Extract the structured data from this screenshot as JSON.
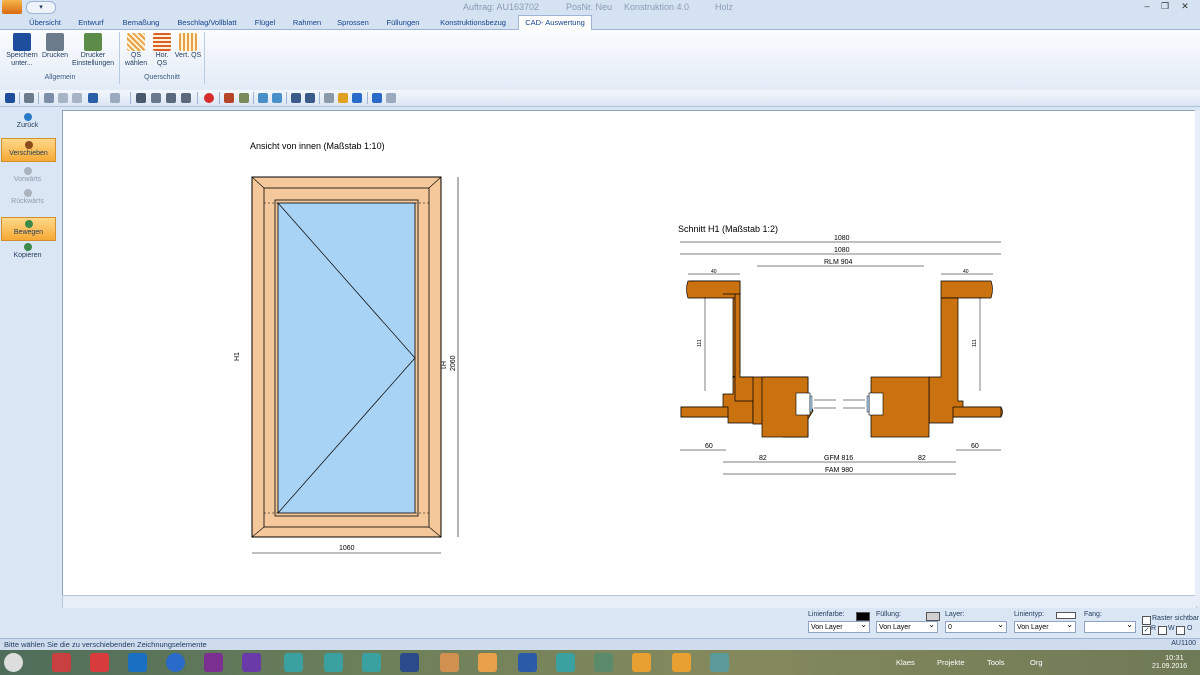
{
  "titlebar": {
    "quick_access": "▾",
    "auftrag": "Auftrag: AU163702",
    "posnr": "PosNr. Neu",
    "konstruktion": "Konstruktion 4.0",
    "material": "Holz",
    "minimize": "–",
    "restore": "❐",
    "close": "✕"
  },
  "tabs": [
    "Übersicht",
    "Entwurf",
    "Bemaßung",
    "Beschlag/Vollblatt",
    "Flügel",
    "Rahmen",
    "Sprossen",
    "Füllungen",
    "Konstruktionsbezug",
    "CAD- Auswertung"
  ],
  "ribbon": {
    "save": "Speichern unter...",
    "print": "Drucken",
    "printer": "Drucker Einstellungen",
    "group_allgemein": "Allgemein",
    "qs_waehlen": "QS wählen",
    "hor_qs": "Hor. QS",
    "vert_qs": "Vert. QS",
    "group_querschnitt": "Querschnitt"
  },
  "left_panel": {
    "back": "Zurück",
    "move_shift": "Verschieben",
    "forward": "Vorwärts",
    "backward": "Rückwärts",
    "move": "Bewegen",
    "copy": "Kopieren"
  },
  "drawing": {
    "view_title": "Ansicht von innen (Maßstab 1:10)",
    "width_dim": "1060",
    "height_dim": "2060",
    "h1_left": "H1",
    "h1_right": "H1",
    "section_title": "Schnitt H1 (Maßstab 1:2)",
    "dim_1080_a": "1080",
    "dim_1080_b": "1080",
    "rlm": "RLM 904",
    "dim_40_left": "40",
    "dim_40_right": "40",
    "dim_111_left": "111",
    "dim_111_right": "111",
    "dim_60_left": "60",
    "dim_60_right": "60",
    "dim_82_left": "82",
    "dim_82_right": "82",
    "gfm": "GFM 816",
    "fam": "FAM 980"
  },
  "props": {
    "linienfarbe_label": "Linienfarbe:",
    "linienfarbe_value": "Von Layer",
    "fuellung_label": "Füllung:",
    "fuellung_value": "Von Layer",
    "layer_label": "Layer:",
    "layer_value": "0",
    "linientyp_label": "Linientyp:",
    "linientyp_value": "Von Layer",
    "fang_label": "Fang:",
    "fang_value": "",
    "raster_label": "Raster sichtbar",
    "r_label": "R",
    "w_label": "W",
    "o_label": "O"
  },
  "status": {
    "message": "Bitte wählen Sie die zu verschiebenden Zeichnungselemente",
    "code": "AU1100"
  },
  "taskbar": {
    "klaes": "Klaes",
    "projekte": "Projekte",
    "tools": "Tools",
    "org": "Org",
    "time": "10:31",
    "date": "21.09.2016"
  },
  "colors": {
    "accent_orange": "#f6a935",
    "frame_wood": "#f4c89a",
    "glass": "#a9d3f5",
    "section_wood": "#c9720f"
  }
}
